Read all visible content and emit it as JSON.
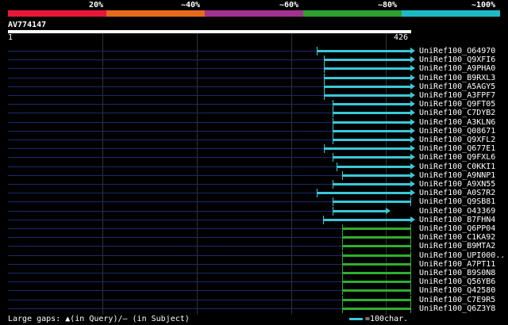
{
  "scale": {
    "labels": [
      "20%",
      "~40%",
      "~60%",
      "~80%",
      "~100%"
    ],
    "bands": [
      {
        "color": "#e8173a"
      },
      {
        "color": "#e66a1a"
      },
      {
        "color": "#a3318f"
      },
      {
        "color": "#2ea12e"
      },
      {
        "color": "#1fb8c6"
      }
    ]
  },
  "query": {
    "name": "AV774147",
    "start": "1",
    "end": "426",
    "length": 426
  },
  "colors": {
    "cyan": "#3ac8d8",
    "green": "#2fae2f",
    "query_line": "#1b2a6a",
    "grid": "#333333"
  },
  "hits": [
    {
      "label": "UniRef100_O64970",
      "start": 326,
      "end": 426,
      "color": "cyan",
      "arrow": true
    },
    {
      "label": "UniRef100_Q9XFI6",
      "start": 334,
      "end": 426,
      "color": "cyan",
      "arrow": true
    },
    {
      "label": "UniRef100_A9PHA0",
      "start": 334,
      "end": 426,
      "color": "cyan",
      "arrow": true
    },
    {
      "label": "UniRef100_B9RXL3",
      "start": 334,
      "end": 426,
      "color": "cyan",
      "arrow": true
    },
    {
      "label": "UniRef100_A5AGY5",
      "start": 334,
      "end": 426,
      "color": "cyan",
      "arrow": true
    },
    {
      "label": "UniRef100_A3FPF7",
      "start": 334,
      "end": 426,
      "color": "cyan",
      "arrow": true
    },
    {
      "label": "UniRef100_Q9FT05",
      "start": 343,
      "end": 426,
      "color": "cyan",
      "arrow": true
    },
    {
      "label": "UniRef100_C7DYB2",
      "start": 343,
      "end": 426,
      "color": "cyan",
      "arrow": true
    },
    {
      "label": "UniRef100_A3KLN6",
      "start": 343,
      "end": 426,
      "color": "cyan",
      "arrow": true
    },
    {
      "label": "UniRef100_Q08671",
      "start": 343,
      "end": 426,
      "color": "cyan",
      "arrow": true
    },
    {
      "label": "UniRef100_Q9XFL2",
      "start": 343,
      "end": 426,
      "color": "cyan",
      "arrow": true
    },
    {
      "label": "UniRef100_Q677E1",
      "start": 334,
      "end": 426,
      "color": "cyan",
      "arrow": true
    },
    {
      "label": "UniRef100_Q9FXL6",
      "start": 343,
      "end": 426,
      "color": "cyan",
      "arrow": true
    },
    {
      "label": "UniRef100_C0KKI1",
      "start": 347,
      "end": 426,
      "color": "cyan",
      "arrow": true
    },
    {
      "label": "UniRef100_A9NNP1",
      "start": 353,
      "end": 426,
      "color": "cyan",
      "arrow": true
    },
    {
      "label": "UniRef100_A9XN55",
      "start": 343,
      "end": 426,
      "color": "cyan",
      "arrow": true
    },
    {
      "label": "UniRef100_A0S7R2",
      "start": 326,
      "end": 426,
      "color": "cyan",
      "arrow": true
    },
    {
      "label": "UniRef100_Q9SB81",
      "start": 343,
      "end": 426,
      "color": "cyan",
      "arrow": false
    },
    {
      "label": "UniRef100_O43369",
      "start": 343,
      "end": 400,
      "color": "cyan",
      "arrow": true
    },
    {
      "label": "UniRef100_B7FHN4",
      "start": 333,
      "end": 426,
      "color": "cyan",
      "arrow": true
    },
    {
      "label": "UniRef100_Q6PP04",
      "start": 353,
      "end": 426,
      "color": "green",
      "arrow": false
    },
    {
      "label": "UniRef100_C1KA92",
      "start": 353,
      "end": 426,
      "color": "green",
      "arrow": false
    },
    {
      "label": "UniRef100_B9MTA2",
      "start": 353,
      "end": 426,
      "color": "green",
      "arrow": false
    },
    {
      "label": "UniRef100_UPI000..",
      "start": 353,
      "end": 426,
      "color": "green",
      "arrow": false
    },
    {
      "label": "UniRef100_A7PT11",
      "start": 353,
      "end": 426,
      "color": "green",
      "arrow": false
    },
    {
      "label": "UniRef100_B9S0N8",
      "start": 353,
      "end": 426,
      "color": "green",
      "arrow": false
    },
    {
      "label": "UniRef100_Q56YB6",
      "start": 353,
      "end": 426,
      "color": "green",
      "arrow": false
    },
    {
      "label": "UniRef100_Q42580",
      "start": 353,
      "end": 426,
      "color": "green",
      "arrow": false
    },
    {
      "label": "UniRef100_C7E9R5",
      "start": 353,
      "end": 426,
      "color": "green",
      "arrow": false
    },
    {
      "label": "UniRef100_Q6Z3Y8",
      "start": 353,
      "end": 426,
      "color": "green",
      "arrow": false
    }
  ],
  "footer": {
    "gaps_text": "Large gaps: ▲(in Query)/– (in Subject)",
    "legend_text": "=100char."
  }
}
